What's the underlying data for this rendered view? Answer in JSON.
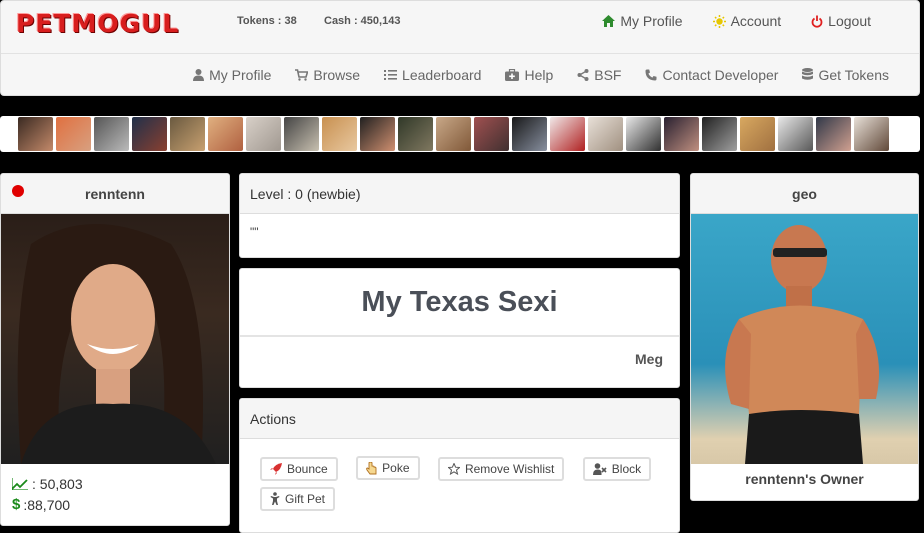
{
  "brand": {
    "logo_text": "PETMOGUL"
  },
  "stats": {
    "tokens": "Tokens : 38",
    "cash": "Cash : 450,143"
  },
  "top_links": [
    {
      "label": "My Profile",
      "icon": "home-icon"
    },
    {
      "label": "Account",
      "icon": "sun-icon"
    },
    {
      "label": "Logout",
      "icon": "power-icon"
    }
  ],
  "nav": [
    {
      "label": "My Profile",
      "icon": "user-icon"
    },
    {
      "label": "Browse",
      "icon": "cart-icon"
    },
    {
      "label": "Leaderboard",
      "icon": "list-icon"
    },
    {
      "label": "Help",
      "icon": "medkit-icon"
    },
    {
      "label": "BSF",
      "icon": "share-icon"
    },
    {
      "label": "Contact Developer",
      "icon": "phone-icon"
    },
    {
      "label": "Get Tokens",
      "icon": "database-icon"
    }
  ],
  "pet": {
    "username": "renntenn",
    "online_status_color": "#e00000",
    "value": ": 50,803",
    "price": ":88,700"
  },
  "level": {
    "label": "Level : 0 (newbie)",
    "quote": "\"\""
  },
  "title_card": {
    "title": "My Texas Sexi",
    "signature": "Meg"
  },
  "actions": {
    "heading": "Actions",
    "buttons": [
      {
        "label": "Bounce",
        "icon": "rocket-icon"
      },
      {
        "label": "Poke",
        "icon": "hand-pointer-icon"
      },
      {
        "label": "Remove Wishlist",
        "icon": "star-outline-icon"
      },
      {
        "label": "Block",
        "icon": "user-block-icon"
      },
      {
        "label": "Gift Pet",
        "icon": "child-icon"
      }
    ]
  },
  "owner": {
    "username": "geo",
    "caption": "renntenn's Owner"
  },
  "colors": {
    "logo_red": "#d81e1e",
    "link_green": "#2e8b2e",
    "account_yellow": "#e6c700",
    "logout_red": "#e02020",
    "stat_green": "#1a8a1a"
  }
}
